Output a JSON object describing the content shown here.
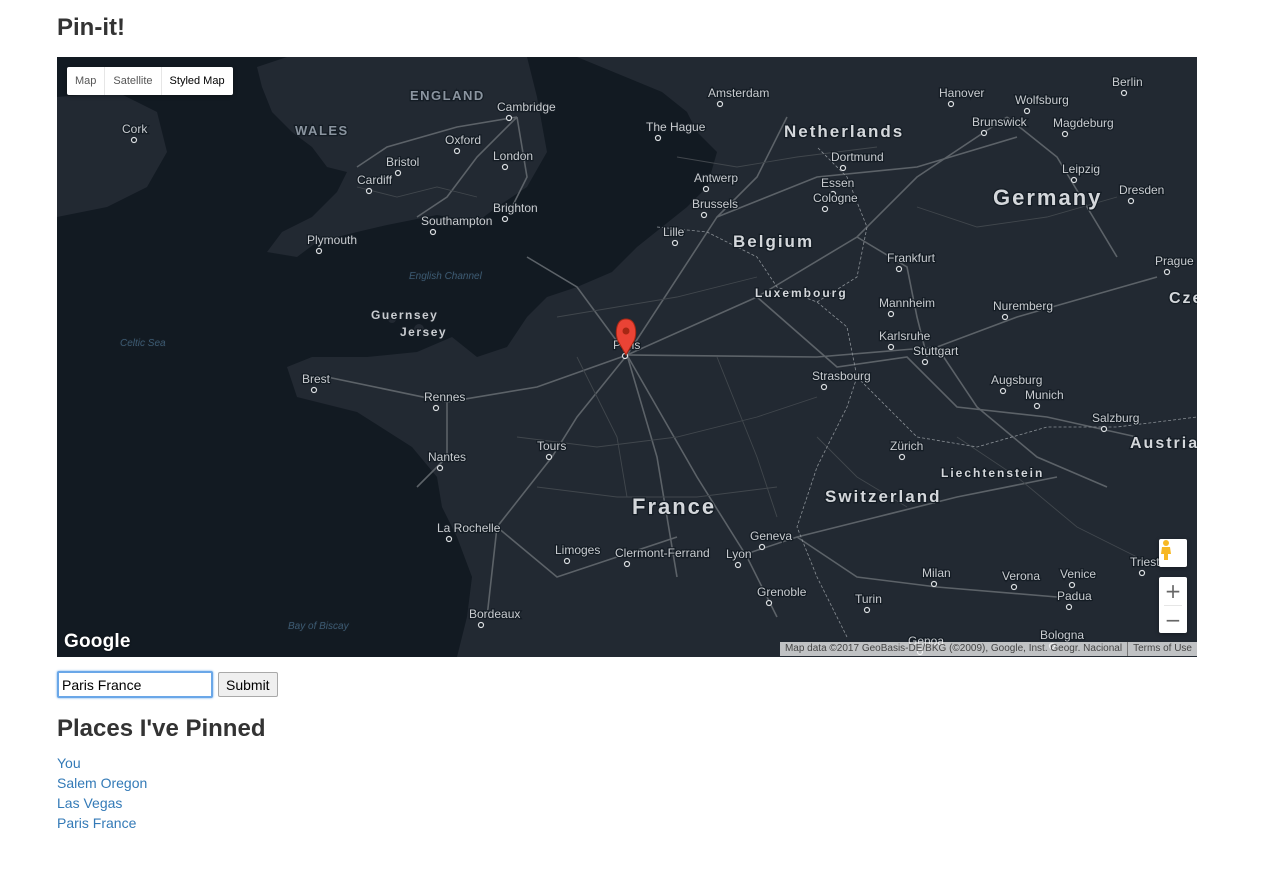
{
  "page": {
    "title": "Pin-it!"
  },
  "map": {
    "type_buttons": [
      {
        "label": "Map",
        "active": false
      },
      {
        "label": "Satellite",
        "active": false
      },
      {
        "label": "Styled Map",
        "active": true
      }
    ],
    "labels": {
      "countries": [
        "Netherlands",
        "Belgium",
        "Germany",
        "Luxembourg",
        "France",
        "Switzerland",
        "Liechtenstein",
        "Austria",
        "Cze"
      ],
      "regions": [
        "ENGLAND",
        "WALES",
        "Guernsey",
        "Jersey"
      ],
      "seas": [
        "English Channel",
        "Celtic Sea",
        "Bay of Biscay"
      ],
      "cities": [
        "Cork",
        "Cambridge",
        "Oxford",
        "London",
        "Bristol",
        "Cardiff",
        "Southampton",
        "Brighton",
        "Plymouth",
        "Amsterdam",
        "The Hague",
        "Antwerp",
        "Brussels",
        "Lille",
        "Dortmund",
        "Essen",
        "Cologne",
        "Hanover",
        "Wolfsburg",
        "Brunswick",
        "Magdeburg",
        "Berlin",
        "Leipzig",
        "Dresden",
        "Prague",
        "Frankfurt",
        "Mannheim",
        "Karlsruhe",
        "Stuttgart",
        "Nuremberg",
        "Strasbourg",
        "Augsburg",
        "Munich",
        "Salzburg",
        "Zürich",
        "Paris",
        "Brest",
        "Rennes",
        "Nantes",
        "Tours",
        "La Rochelle",
        "Limoges",
        "Clermont-Ferrand",
        "Lyon",
        "Geneva",
        "Grenoble",
        "Turin",
        "Milan",
        "Verona",
        "Venice",
        "Padua",
        "Trieste",
        "Bordeaux",
        "Genoa",
        "Bologna"
      ]
    },
    "marker": {
      "label": "Paris",
      "color": "#ea4335"
    },
    "logo": "Google",
    "attribution": "Map data ©2017 GeoBasis-DE/BKG (©2009), Google, Inst. Geogr. Nacional",
    "terms": "Terms of Use",
    "zoom_in": "+",
    "zoom_out": "−",
    "colors": {
      "land": "#222932",
      "water": "#121a22",
      "roads": "#5c6268",
      "text": "#c9ccd0"
    }
  },
  "search": {
    "value": "Paris France",
    "submit_label": "Submit"
  },
  "pinned": {
    "heading": "Places I've Pinned",
    "places": [
      "You",
      "Salem Oregon",
      "Las Vegas",
      "Paris France"
    ]
  }
}
